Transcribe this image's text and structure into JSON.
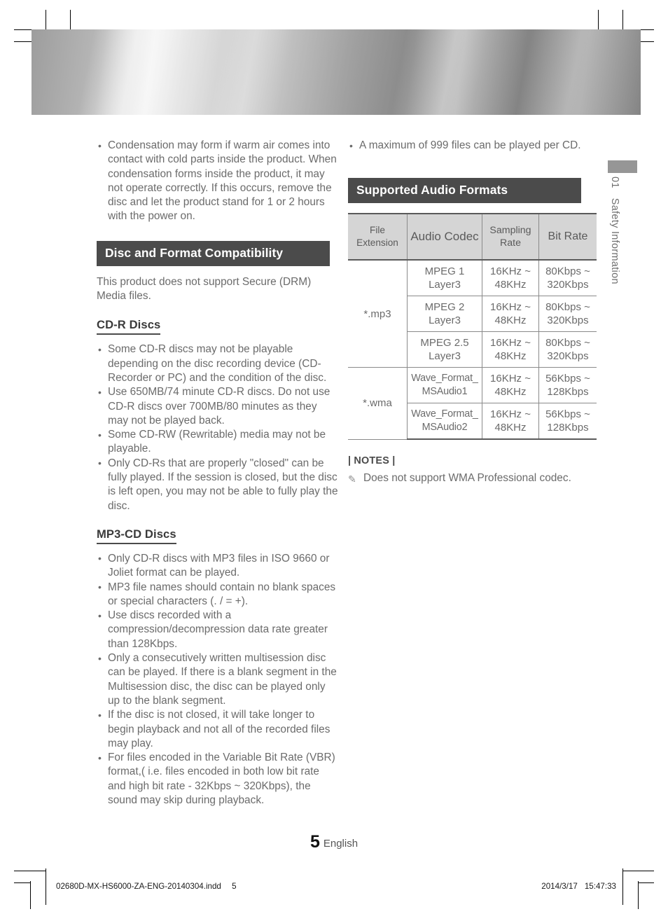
{
  "page": {
    "number": "5",
    "language": "English",
    "side_tab": {
      "chapter_number": "01",
      "chapter_title": "Safety Information"
    },
    "footer": {
      "file_name": "02680D-MX-HS6000-ZA-ENG-20140304.indd",
      "file_page": "5",
      "print_date": "2014/3/17",
      "print_time": "15:47:33"
    }
  },
  "colors": {
    "section_bar_bg": "#4b4b4b",
    "section_bar_text": "#ffffff",
    "body_text": "#6b6b6b",
    "heading_text": "#3a3a3a",
    "table_header_bg": "#d5d5d5",
    "table_border": "#8a8a8a",
    "table_rule": "#5a5a5a",
    "side_tab_block": "#969696"
  },
  "left_column": {
    "intro_bullets": [
      "Condensation may form if warm air comes into contact with cold parts inside the product. When condensation forms inside the product, it may not operate correctly. If this occurs, remove the disc and let the product stand for 1 or 2 hours with the power on."
    ],
    "section": {
      "title": "Disc and Format Compatibility",
      "intro": "This product does not support Secure (DRM) Media files."
    },
    "subsections": [
      {
        "heading": "CD-R Discs",
        "bullets": [
          "Some CD-R discs may not be playable depending on the disc recording device (CD-Recorder or PC) and the condition of the disc.",
          "Use 650MB/74 minute CD-R discs. Do not use CD-R discs over 700MB/80 minutes as they may not be played back.",
          "Some CD-RW (Rewritable) media may not be playable.",
          "Only CD-Rs that are properly \"closed\" can be fully played. If the session is closed, but the disc is left open, you may not be able to fully play the disc."
        ]
      },
      {
        "heading": "MP3-CD Discs",
        "bullets": [
          "Only CD-R discs with MP3 files in ISO 9660 or Joliet format can be played.",
          "MP3 file names should contain no blank spaces or special characters (. / = +).",
          "Use discs recorded with a compression/decompression data rate greater than 128Kbps.",
          "Only a consecutively written multisession disc can be played. If there is a blank segment in the Multisession disc, the disc can be played only up to the blank segment.",
          "If the disc is not closed, it will take longer to begin playback and not all of the recorded files may play.",
          "For files encoded in the Variable Bit Rate (VBR) format,( i.e. files encoded in both low bit rate and high bit rate - 32Kbps ~ 320Kbps), the sound may skip during playback."
        ]
      }
    ]
  },
  "right_column": {
    "top_bullets": [
      "A maximum of 999 files can be played per CD."
    ],
    "section": {
      "title": "Supported Audio Formats"
    },
    "table": {
      "headers": [
        "File Extension",
        "Audio Codec",
        "Sampling Rate",
        "Bit Rate"
      ],
      "groups": [
        {
          "file_extension": "*.mp3",
          "rows": [
            {
              "codec": "MPEG 1 Layer3",
              "sampling_rate": "16KHz ~ 48KHz",
              "bit_rate": "80Kbps ~ 320Kbps"
            },
            {
              "codec": "MPEG 2 Layer3",
              "sampling_rate": "16KHz ~ 48KHz",
              "bit_rate": "80Kbps ~ 320Kbps"
            },
            {
              "codec": "MPEG 2.5 Layer3",
              "sampling_rate": "16KHz ~ 48KHz",
              "bit_rate": "80Kbps ~ 320Kbps"
            }
          ]
        },
        {
          "file_extension": "*.wma",
          "rows": [
            {
              "codec": "Wave_Format_ MSAudio1",
              "sampling_rate": "16KHz ~ 48KHz",
              "bit_rate": "56Kbps ~ 128Kbps"
            },
            {
              "codec": "Wave_Format_ MSAudio2",
              "sampling_rate": "16KHz ~ 48KHz",
              "bit_rate": "56Kbps ~ 128Kbps"
            }
          ]
        }
      ]
    },
    "notes": {
      "title": "| NOTES |",
      "icon": "pencil-icon",
      "items": [
        "Does not support WMA Professional codec."
      ]
    }
  }
}
